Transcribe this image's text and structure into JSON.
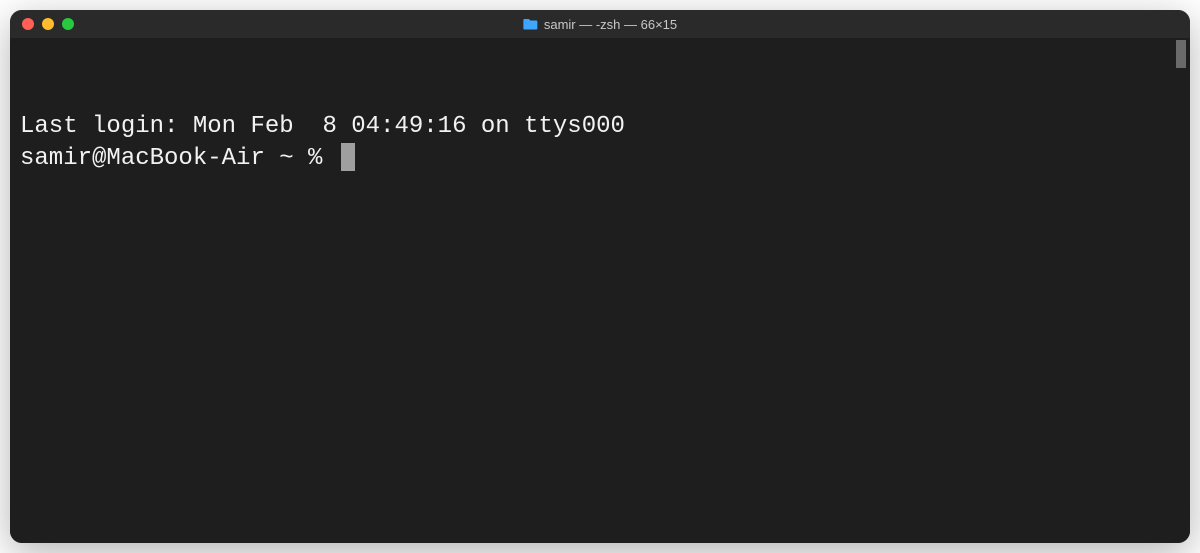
{
  "titlebar": {
    "folder_icon": "folder-icon",
    "title": "samir — -zsh — 66×15"
  },
  "terminal": {
    "last_login_line": "Last login: Mon Feb  8 04:49:16 on ttys000",
    "prompt": "samir@MacBook-Air ~ % "
  }
}
